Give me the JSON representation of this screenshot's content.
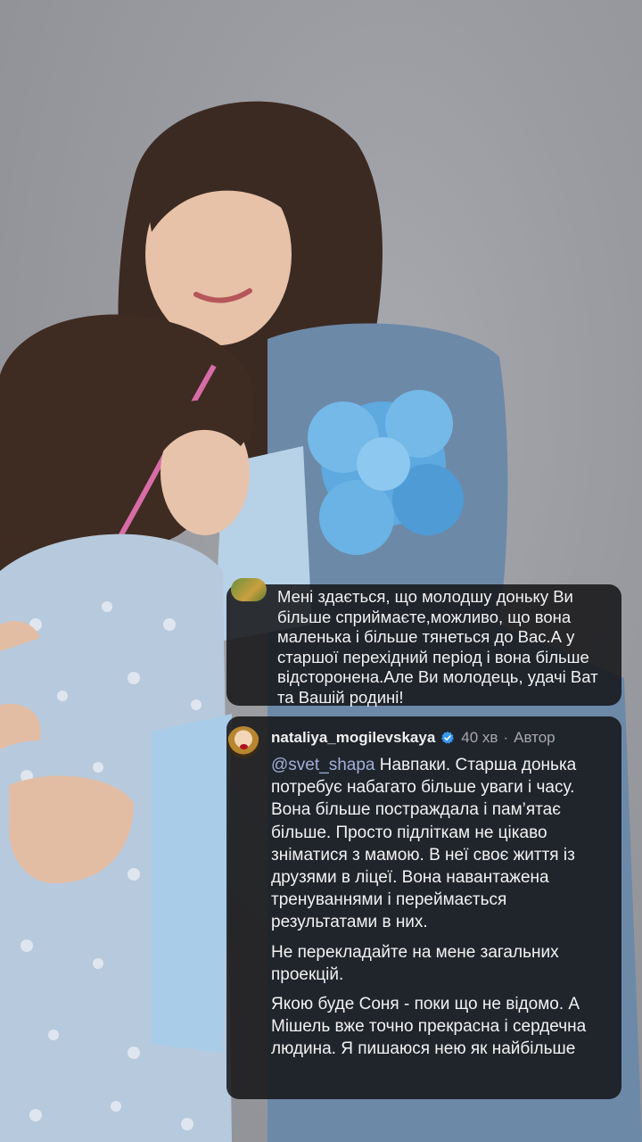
{
  "story": {
    "comment1": {
      "text": "Мені здається, що молодшу доньку Ви більше сприймаєте,можливо, що вона маленька і більше тянеться до Вас.А у старшої перехідний період і вона більше відсторонена.Але Ви молодець, удачі Ват та Вашій родині!"
    },
    "comment2": {
      "username": "nataliya_mogilevskaya",
      "time": "40 хв",
      "separator": "·",
      "author_label": "Автор",
      "mention": "@svet_shapa",
      "paragraph1": "Навпаки. Старша донька потребує набагато більше уваги і часу. Вона більше постраждала і пам’ятає більше. Просто підліткам не цікаво зніматися з мамою. В неї своє життя із друзями в ліцеї. Вона навантажена тренуваннями і переймається результатами в них.",
      "paragraph2": "Не перекладайте на мене загальних проекцій.",
      "paragraph3": "Якою буде Соня - поки що не відомо. А Мішель вже точно прекрасна і сердечна людина. Я пишаюся нею як найбільше"
    },
    "colors": {
      "card_bg": "#141416",
      "mention": "#9fb0d8",
      "verified": "#3897f0"
    },
    "icons": [
      "verified-badge-icon"
    ]
  }
}
